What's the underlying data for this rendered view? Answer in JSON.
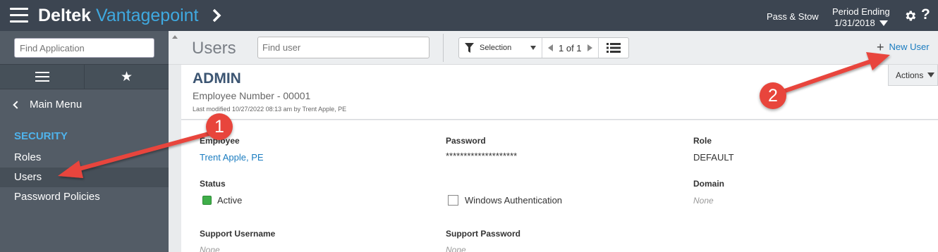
{
  "topbar": {
    "brand_primary": "Deltek",
    "brand_secondary": "Vantagepoint",
    "company": "Pass & Stow",
    "period_label": "Period Ending",
    "period_date": "1/31/2018",
    "icons": [
      "hamburger-icon",
      "chevron-right-icon",
      "gear-icon",
      "help-icon"
    ]
  },
  "sidebar": {
    "search_placeholder": "Find Application",
    "main_menu": "Main Menu",
    "section": "SECURITY",
    "items": [
      {
        "label": "Roles"
      },
      {
        "label": "Users"
      },
      {
        "label": "Password Policies"
      }
    ]
  },
  "toolbar": {
    "title": "Users",
    "find_placeholder": "Find user",
    "selection": "Selection",
    "pager": "1 of 1",
    "new_user": "New User"
  },
  "record": {
    "name": "ADMIN",
    "employee_number": "Employee Number - 00001",
    "last_modified": "Last modified 10/27/2022 08:13 am by Trent Apple, PE",
    "actions": "Actions"
  },
  "form": {
    "employee_label": "Employee",
    "employee_value": "Trent Apple, PE",
    "password_label": "Password",
    "password_value": "********************",
    "role_label": "Role",
    "role_value": "DEFAULT",
    "status_label": "Status",
    "status_value": "Active",
    "windows_auth_label": "Windows Authentication",
    "domain_label": "Domain",
    "domain_value": "None",
    "support_username_label": "Support Username",
    "support_username_value": "None",
    "support_password_label": "Support Password",
    "support_password_value": "None"
  },
  "annotations": {
    "badge_1": "1",
    "badge_2": "2",
    "color": "#e8453c"
  }
}
